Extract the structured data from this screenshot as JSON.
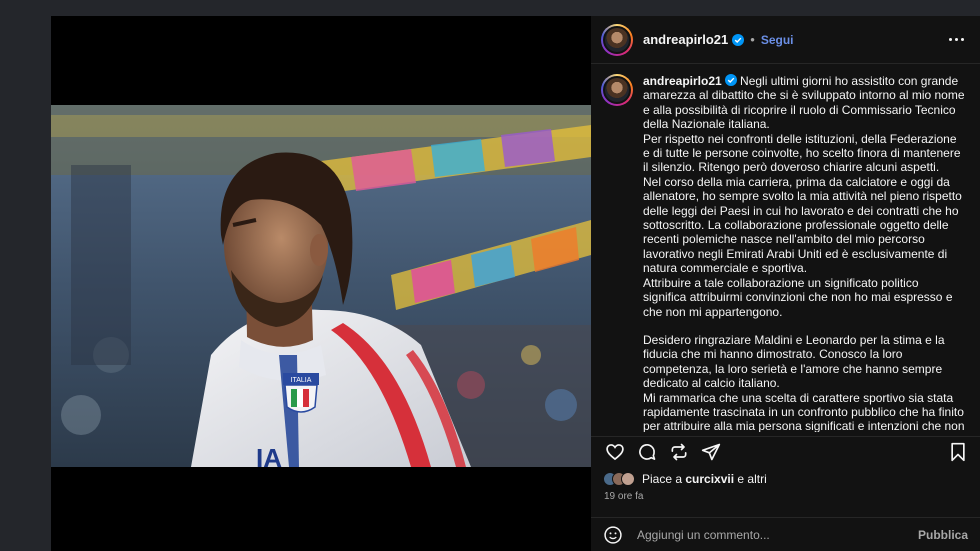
{
  "post": {
    "username": "andreapirlo21",
    "follow_label": "Segui",
    "separator": "•",
    "verified_icon": "verified-badge-icon",
    "jersey_text": "ITALIA",
    "jersey_bottom_text": "IA"
  },
  "caption": {
    "username": "andreapirlo21",
    "p1": "Negli ultimi giorni ho assistito con grande amarezza al dibattito che si è sviluppato intorno al mio nome e alla possibilità di ricoprire il ruolo di Commissario Tecnico della Nazionale italiana.",
    "p2": "Per rispetto nei confronti delle istituzioni, della Federazione e di tutte le persone coinvolte, ho scelto finora di mantenere il silenzio. Ritengo però doveroso chiarire alcuni aspetti.",
    "p3": "Nel corso della mia carriera, prima da calciatore e oggi da allenatore, ho sempre svolto la mia attività nel pieno rispetto delle leggi dei Paesi in cui ho lavorato e dei contratti che ho sottoscritto. La collaborazione professionale oggetto delle recenti polemiche nasce nell'ambito del mio percorso lavorativo negli Emirati Arabi Uniti ed è esclusivamente di natura commerciale e sportiva.",
    "p4": "Attribuire a tale collaborazione un significato politico significa attribuirmi convinzioni che non ho mai espresso e che non mi appartengono.",
    "p5": "Desidero ringraziare Maldini e Leonardo per la stima e la fiducia che mi hanno dimostrato. Conosco la loro competenza, la loro serietà e l'amore che hanno sempre dedicato al calcio italiano.",
    "p6": "Mi rammarica che una scelta di carattere sportivo sia stata rapidamente trascinata in un confronto pubblico che ha finito per attribuire alla mia persona significati e intenzioni che non"
  },
  "likes": {
    "prefix": "Piace a ",
    "user": "curcixvii",
    "suffix": " e altri"
  },
  "timestamp": "19 ore fa",
  "comment": {
    "placeholder": "Aggiungi un commento...",
    "publish_label": "Pubblica"
  },
  "colors": {
    "background": "#24262b",
    "panel": "#121212",
    "link_blue": "#6b8fe6",
    "verified_blue": "#0095f6",
    "muted": "#a8a8a8"
  }
}
